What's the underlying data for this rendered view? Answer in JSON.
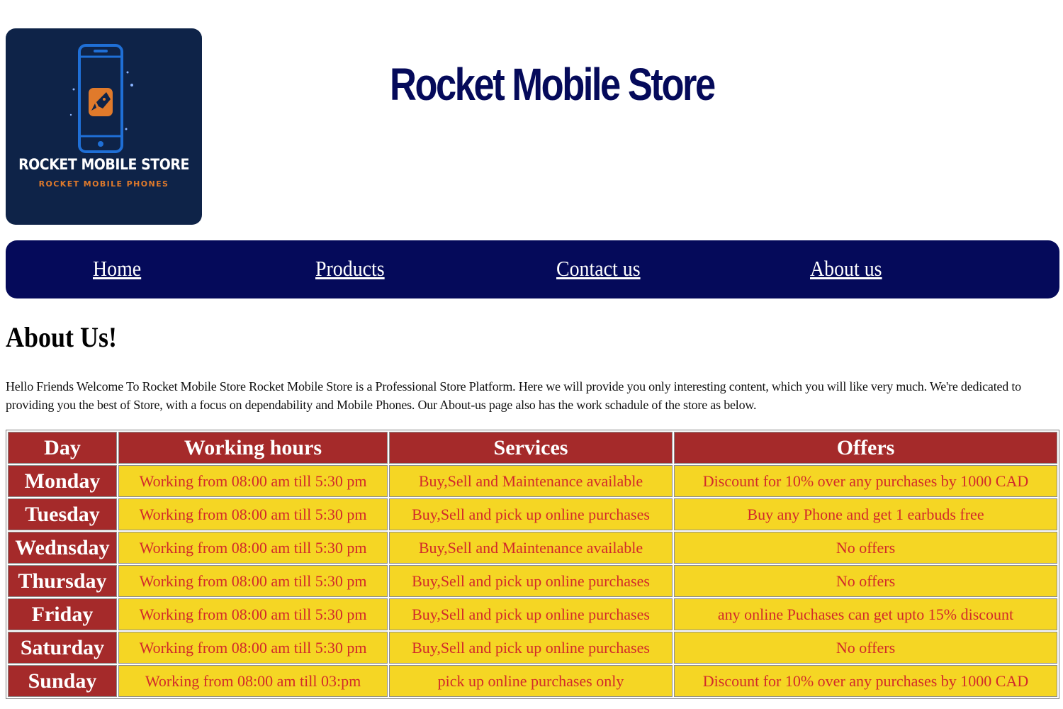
{
  "logo": {
    "title": "ROCKET MOBILE STORE",
    "subtitle": "ROCKET MOBILE PHONES",
    "icon": "rocket-phone-logo",
    "colors": {
      "background": "#0e2348",
      "phone": "#1f6fd6",
      "rocket": "#e07a2b"
    }
  },
  "header": {
    "title": "Rocket Mobile Store"
  },
  "nav": {
    "items": [
      {
        "label": "Home"
      },
      {
        "label": "Products"
      },
      {
        "label": "Contact us"
      },
      {
        "label": "About us"
      }
    ]
  },
  "main": {
    "heading": "About Us!",
    "intro": "Hello Friends Welcome To Rocket Mobile Store Rocket Mobile Store is a Professional Store Platform. Here we will provide you only interesting content, which you will like very much. We're dedicated to providing you the best of Store, with a focus on dependability and Mobile Phones. Our About-us page also has the work schadule of the store as below."
  },
  "schedule": {
    "headers": [
      "Day",
      "Working hours",
      "Services",
      "Offers"
    ],
    "rows": [
      {
        "day": "Monday",
        "hours": "Working from 08:00 am till 5:30 pm",
        "services": "Buy,Sell and Maintenance available",
        "offers": "Discount for 10% over any purchases by 1000 CAD"
      },
      {
        "day": "Tuesday",
        "hours": "Working from 08:00 am till 5:30 pm",
        "services": "Buy,Sell and pick up online purchases",
        "offers": "Buy any Phone and get 1 earbuds free"
      },
      {
        "day": "Wednsday",
        "hours": "Working from 08:00 am till 5:30 pm",
        "services": "Buy,Sell and Maintenance available",
        "offers": "No offers"
      },
      {
        "day": "Thursday",
        "hours": "Working from 08:00 am till 5:30 pm",
        "services": "Buy,Sell and pick up online purchases",
        "offers": "No offers"
      },
      {
        "day": "Friday",
        "hours": "Working from 08:00 am till 5:30 pm",
        "services": "Buy,Sell and pick up online purchases",
        "offers": "any online Puchases can get upto 15% discount"
      },
      {
        "day": "Saturday",
        "hours": "Working from 08:00 am till 5:30 pm",
        "services": "Buy,Sell and pick up online purchases",
        "offers": "No offers"
      },
      {
        "day": "Sunday",
        "hours": "Working from 08:00 am till 03:pm",
        "services": "pick up online purchases only",
        "offers": "Discount for 10% over any purchases by 1000 CAD"
      }
    ]
  },
  "colors": {
    "navy": "#050a5a",
    "table_header": "#a52a2a",
    "cell_background": "#f5d624",
    "cell_text": "#d22a2a"
  }
}
